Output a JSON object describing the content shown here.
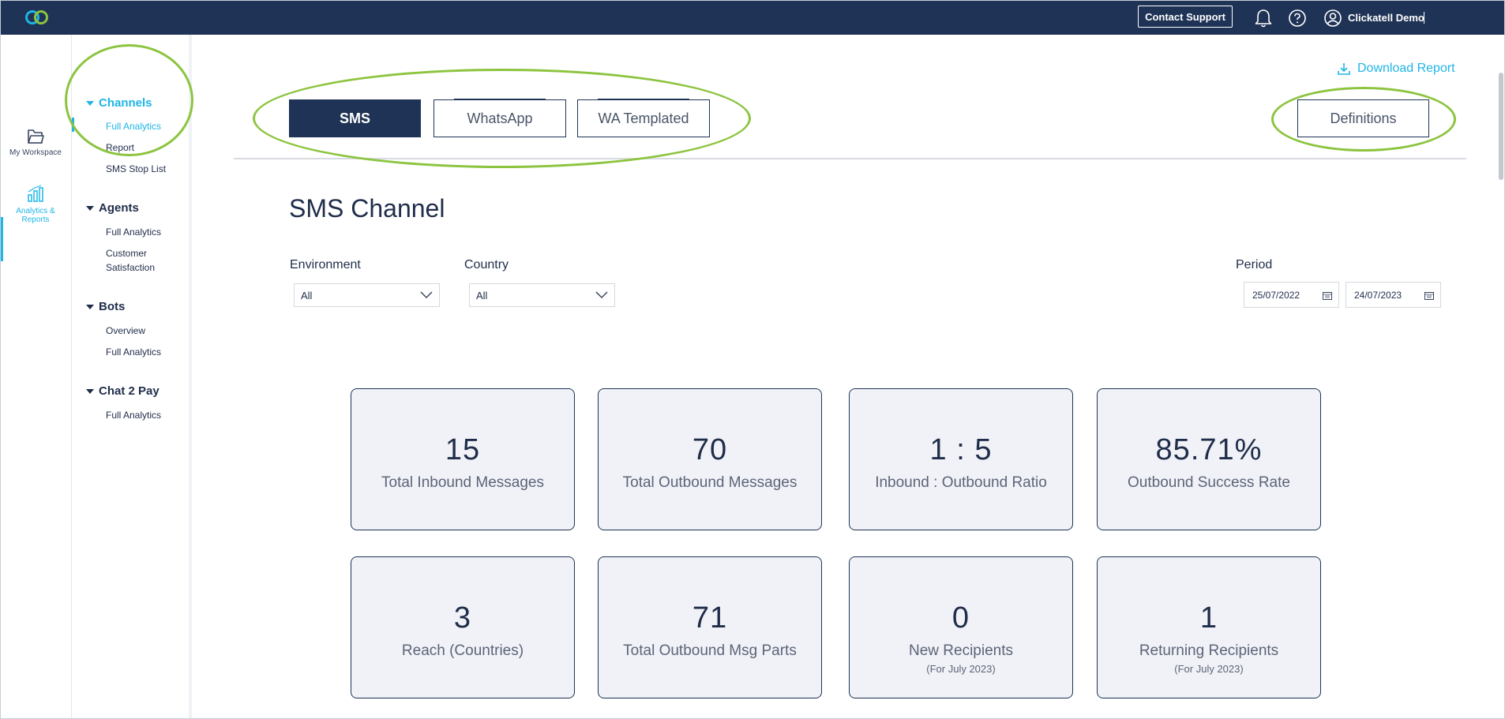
{
  "topbar": {
    "contact_support": "Contact Support",
    "user_name": "Clickatell Demo"
  },
  "rail": {
    "items": [
      {
        "label": "My Workspace",
        "icon": "folder-icon"
      },
      {
        "label_line1": "Analytics &",
        "label_line2": "Reports",
        "icon": "bar-chart-icon"
      }
    ]
  },
  "submenu": {
    "channels": {
      "title": "Channels",
      "items": [
        "Full Analytics",
        "Report",
        "SMS Stop List"
      ]
    },
    "agents": {
      "title": "Agents",
      "items": [
        "Full Analytics",
        "Customer Satisfaction"
      ]
    },
    "bots": {
      "title": "Bots",
      "items": [
        "Overview",
        "Full Analytics"
      ]
    },
    "chat2pay": {
      "title": "Chat 2 Pay",
      "items": [
        "Full Analytics"
      ]
    }
  },
  "main": {
    "download_report": "Download Report",
    "tabs": [
      "SMS",
      "WhatsApp",
      "WA Templated"
    ],
    "definitions": "Definitions",
    "page_title": "SMS Channel",
    "filters": {
      "environment_label": "Environment",
      "environment_value": "All",
      "country_label": "Country",
      "country_value": "All",
      "period_label": "Period",
      "date_from": "25/07/2022",
      "date_to": "24/07/2023"
    },
    "kpis": [
      {
        "value": "15",
        "label": "Total Inbound Messages"
      },
      {
        "value": "70",
        "label": "Total Outbound Messages"
      },
      {
        "value": "1 : 5",
        "label": "Inbound : Outbound Ratio"
      },
      {
        "value": "85.71%",
        "label": "Outbound Success Rate"
      },
      {
        "value": "3",
        "label": "Reach (Countries)"
      },
      {
        "value": "71",
        "label": "Total Outbound Msg Parts"
      },
      {
        "value": "0",
        "label": "New Recipients",
        "sub": "(For July 2023)"
      },
      {
        "value": "1",
        "label": "Returning Recipients",
        "sub": "(For July 2023)"
      }
    ]
  },
  "colors": {
    "navy": "#1f3356",
    "accent": "#1fb5e6",
    "highlight": "#8cc43f",
    "card_bg": "#f1f2f7"
  }
}
